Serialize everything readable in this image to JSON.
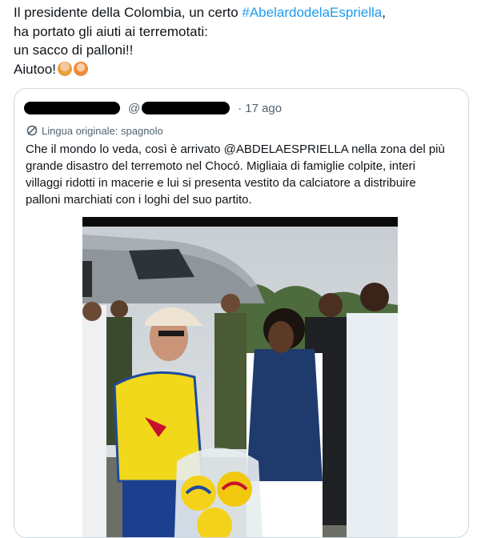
{
  "tweet": {
    "line1_prefix": "Il presidente della Colombia, un certo ",
    "hashtag": "#AbelardodelaEspriella",
    "line1_suffix": ",",
    "line2": "ha portato gli aiuti ai terremotati:",
    "line3": "un sacco di palloni!!",
    "line4": "Aiutoo!",
    "emojis": [
      "person-facepalming-emoji",
      "person-gesturing-no-emoji"
    ]
  },
  "quote": {
    "at_sign": "@",
    "separator": "·",
    "time": "17 ago",
    "translation_label": "Lingua originale: spagnolo",
    "text": "Che il mondo lo veda, così è arrivato @ABDELAESPRIELLA nella zona del più grande disastro del terremoto nel Chocó. Migliaia di famiglie colpite, interi villaggi ridotti in macerie e lui si presenta vestito da calciatore a distribuire palloni marchiati con i loghi del suo partito."
  },
  "photo": {
    "description_icon": "photo-of-airport-distribution"
  }
}
